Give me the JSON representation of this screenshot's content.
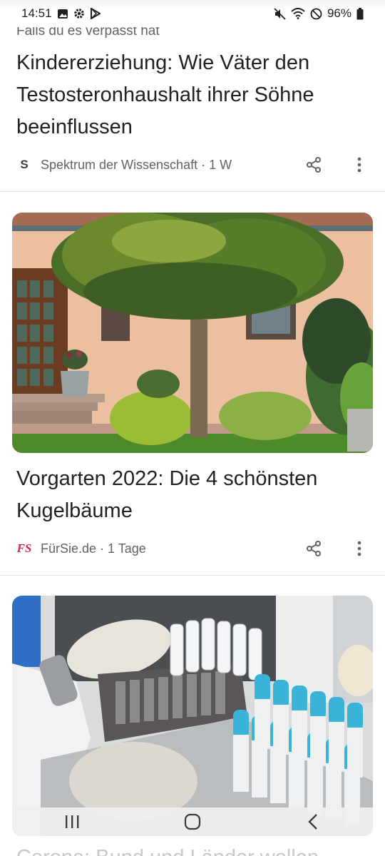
{
  "status_bar": {
    "time": "14:51",
    "battery": "96%",
    "left_icons": [
      "gallery-icon",
      "settings-gear-icon",
      "play-store-icon"
    ],
    "right_icons": [
      "mute-icon",
      "wifi-icon",
      "do-not-disturb-icon",
      "battery-icon"
    ]
  },
  "feed": {
    "section_label": "Falls du es verpasst hat",
    "articles": [
      {
        "headline": "Kindererziehung: Wie Väter den Testosteronhaushalt ihrer Söhne beeinflussen",
        "source_logo": "S",
        "source": "Spektrum der Wissenschaft",
        "age": "· 1 W"
      },
      {
        "headline": "Vorgarten 2022: Die 4 schönsten Kugelbäume",
        "source_logo": "FS",
        "source": "FürSie.de",
        "age": "· 1 Tage",
        "image": "garden-tree-photo"
      },
      {
        "image": "lab-test-tubes-photo"
      }
    ],
    "next_headline_peek": "Corona: Bund und Länder wollen"
  },
  "nav_bar": {
    "icons": [
      "recent-apps-icon",
      "home-icon",
      "back-icon"
    ]
  },
  "colors": {
    "text": "#202124",
    "secondary_text": "#5f6368",
    "fs_brand": "#d8264d",
    "divider": "#e2e2e2"
  }
}
